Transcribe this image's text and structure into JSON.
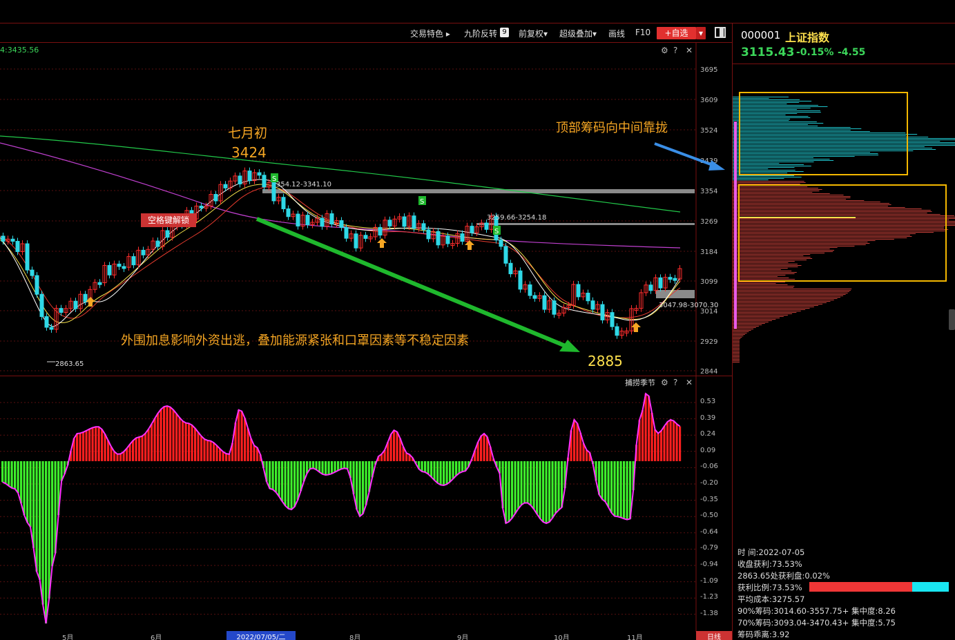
{
  "toolbar": {
    "items": [
      "交易特色 ▸",
      "九阶反转",
      "前复权▾",
      "超级叠加▾",
      "画线",
      "F10"
    ],
    "nine_badge": "9",
    "add_button": "+自选"
  },
  "main_chart": {
    "ma_readout": "4:3435.56",
    "price_ticks": [
      "3695",
      "3609",
      "3524",
      "3439",
      "3354",
      "3269",
      "3184",
      "3099",
      "3014",
      "2929",
      "2844"
    ],
    "unlock_button": "空格键解锁",
    "range_label_1": "354.12-3341.10",
    "range_label_2": "3259.66-3254.18",
    "range_label_3": "3047.98-3070.30",
    "low_label": "2863.65",
    "sell_badge": "S",
    "annotations": {
      "early_july": "七月初",
      "peak": "3424",
      "cause": "外围加息影响外资出逃，叠加能源紧张和口罩因素等不稳定因素",
      "trough": "2885",
      "chips": "顶部筹码向中间靠拢"
    },
    "colors": {
      "up": "#ff2d2d",
      "down": "#2fd8e6",
      "ma_green": "#22c94a",
      "ma_purple": "#c040d0",
      "annot": "#f5a623"
    }
  },
  "sub_chart": {
    "title": "捕捞季节",
    "ticks": [
      "0.53",
      "0.39",
      "0.24",
      "0.09",
      "-0.06",
      "-0.20",
      "-0.35",
      "-0.50",
      "-0.64",
      "-0.79",
      "-0.94",
      "-1.09",
      "-1.23",
      "-1.38"
    ]
  },
  "x_axis": {
    "labels": [
      "5月",
      "6月",
      "2022/07/05/二",
      "8月",
      "9月",
      "10月",
      "11月"
    ],
    "period": "日线"
  },
  "panel": {
    "code": "000001",
    "name": "上证指数",
    "price": "3115.43",
    "pct": "-0.15%",
    "change": "-4.55",
    "info": {
      "time": "时      间:2022-07-05",
      "profit": "收盘获利:73.53%",
      "low_profit": "2863.65处获利盘:0.02%",
      "ratio": "获利比例:73.53%",
      "avg_cost": "平均成本:3275.57",
      "chip90": "90%筹码:3014.60-3557.75+ 集中度:8.26",
      "chip70": "70%筹码:3093.04-3470.43+ 集中度:5.75",
      "deviation": "筹码乖离:3.92"
    },
    "profit_ratio": 0.7353
  }
}
